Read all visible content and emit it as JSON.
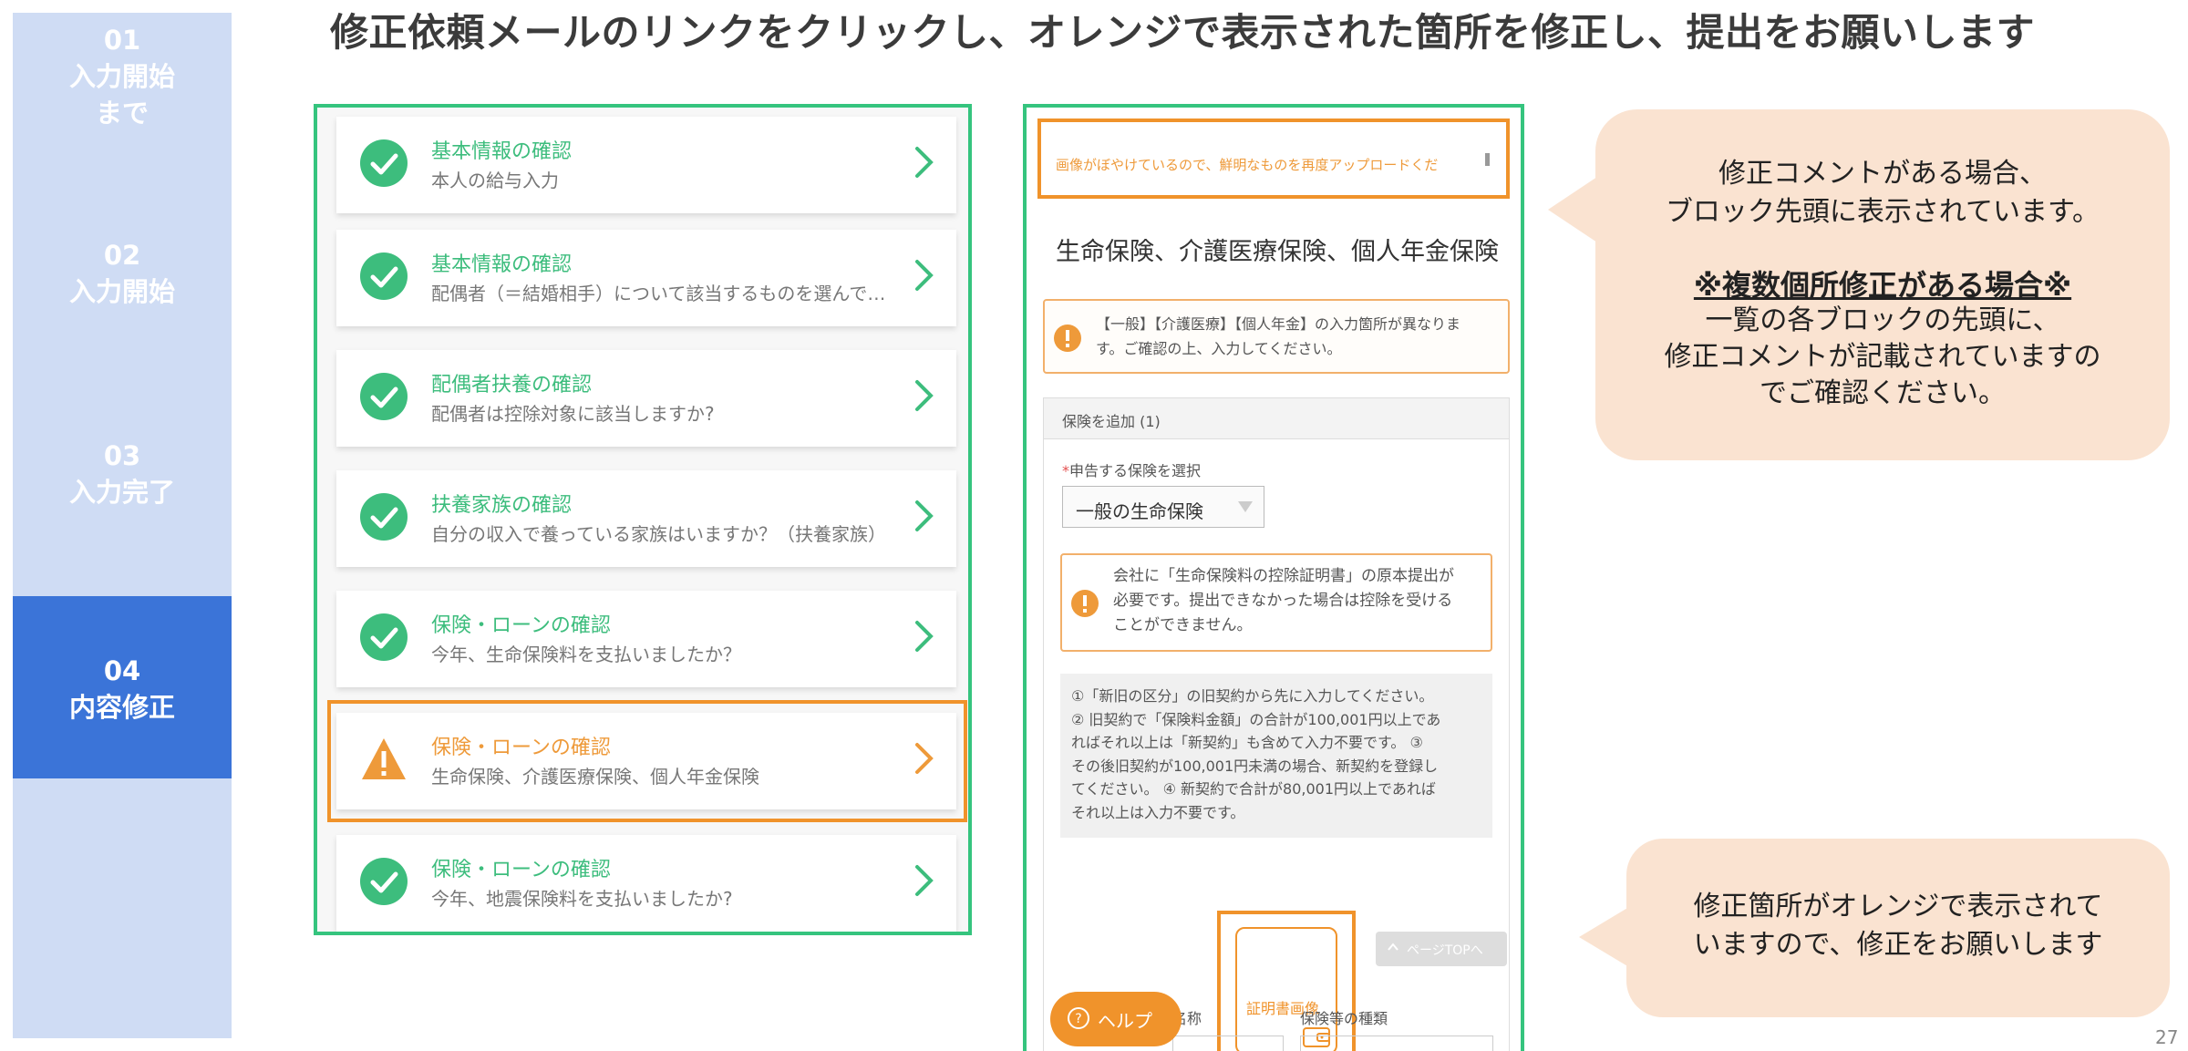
{
  "title": "修正依頼メールのリンクをクリックし、オレンジで表示された箇所を修正し、提出をお願いします",
  "sidebar": {
    "steps": [
      {
        "num": "01",
        "label": "入力開始\nまで",
        "active": false
      },
      {
        "num": "02",
        "label": "入力開始",
        "active": false
      },
      {
        "num": "03",
        "label": "入力完了",
        "active": false
      },
      {
        "num": "04",
        "label": "内容修正",
        "active": true
      }
    ]
  },
  "list": {
    "items": [
      {
        "title": "基本情報の確認",
        "subtitle": "本人の給与入力",
        "status": "done"
      },
      {
        "title": "基本情報の確認",
        "subtitle": "配偶者（＝結婚相手）について該当するものを選んで…",
        "status": "done"
      },
      {
        "title": "配偶者扶養の確認",
        "subtitle": "配偶者は控除対象に該当しますか?",
        "status": "done"
      },
      {
        "title": "扶養家族の確認",
        "subtitle": "自分の収入で養っている家族はいますか？（扶養家族）",
        "status": "done"
      },
      {
        "title": "保険・ローンの確認",
        "subtitle": "今年、生命保険料を支払いましたか？",
        "status": "done"
      },
      {
        "title": "保険・ローンの確認",
        "subtitle": "生命保険、介護医療保険、個人年金保険",
        "status": "needs-fix"
      },
      {
        "title": "保険・ローンの確認",
        "subtitle": "今年、地震保険料を支払いましたか?",
        "status": "done"
      }
    ]
  },
  "form": {
    "comment": "画像がぼやけているので、鮮明なものを再度アップロードくだ",
    "section_title": "生命保険、介護医療保険、個人年金保険",
    "alert1": "【一般】【介護医療】【個人年金】の入力箇所が異なりま\nす。ご確認の上、入力してください。",
    "insurance_header": "保険を追加 (1)",
    "select_label": "申告する保険を選択",
    "select_required_mark": "*",
    "select_value": "一般の生命保険",
    "alert2": "会社に「生命保険料の控除証明書」の原本提出が\n必要です。提出できなかった場合は控除を受ける\nことができません。",
    "info": "①「新旧の区分」の旧契約から先に入力してください。\n② 旧契約で「保険料金額」の合計が100,001円以上であ\nればそれ以上は「新契約」も含めて入力不要です。 ③\nその後旧契約が100,001円未満の場合、新契約を登録し\nてください。 ④ 新契約で合計が80,001円以上であれば\nそれ以上は入力不要です。",
    "cert_label": "証明書画像",
    "page_top_label": "ページTOPへ",
    "help_label": "ヘルプ",
    "name_label": "名称",
    "type_label": "保険等の種類"
  },
  "bubbles": {
    "top_line1": "修正コメントがある場合、\nブロック先頭に表示されています。",
    "top_line2": "※複数個所修正がある場合※",
    "top_line3": "一覧の各ブロックの先頭に、\n修正コメントが記載されていますの\nでご確認ください。",
    "bottom": "修正箇所がオレンジで表示されて\nいますので、修正をお願いします"
  },
  "page_number": "27",
  "colors": {
    "accent_green": "#35c47e",
    "highlight_orange": "#f0932b",
    "sidebar_bg": "#cfdcf4",
    "sidebar_active": "#3b74d8",
    "bubble_bg": "#fae3d1"
  }
}
